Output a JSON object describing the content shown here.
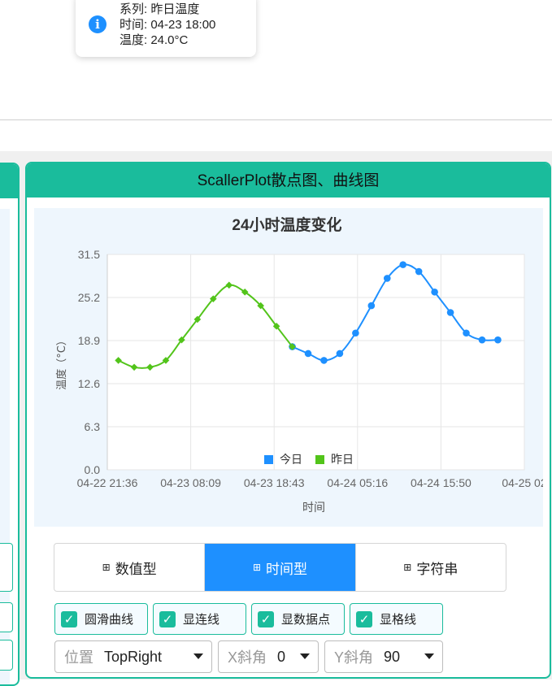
{
  "tooltip": {
    "series_line": "系列: 昨日温度",
    "time_line": "时间: 04-23 18:00",
    "temp_line": "温度: 24.0°C"
  },
  "card": {
    "title": "ScallerPlot散点图、曲线图"
  },
  "chart_data": {
    "type": "line",
    "title": "24小时温度变化",
    "xlabel": "时间",
    "ylabel": "温度（°C）",
    "ylim": [
      0,
      31.5
    ],
    "y_ticks": [
      "31.5",
      "25.2",
      "18.9",
      "12.6",
      "6.3",
      "0.0"
    ],
    "x_ticks": [
      "04-22 21:36",
      "04-23 08:09",
      "04-23 18:43",
      "04-24 05:16",
      "04-24 15:50",
      "04-25 02"
    ],
    "grid": true,
    "legend": {
      "position": "bottom-center",
      "entries": [
        "今日",
        "昨日"
      ]
    },
    "series": [
      {
        "name": "今日",
        "color": "#1e90ff",
        "marker": "circle",
        "x": [
          "04-23 21:00",
          "04-23 23:00",
          "04-24 01:00",
          "04-24 03:00",
          "04-24 05:00",
          "04-24 07:00",
          "04-24 09:00",
          "04-24 11:00",
          "04-24 13:00",
          "04-24 15:00",
          "04-24 17:00",
          "04-24 19:00",
          "04-24 21:00",
          "04-24 23:00"
        ],
        "values": [
          18.0,
          17.0,
          16.0,
          17.0,
          20.0,
          24.0,
          28.0,
          30.0,
          29.0,
          26.0,
          23.0,
          20.0,
          19.0,
          19.0
        ]
      },
      {
        "name": "昨日",
        "color": "#52c41a",
        "marker": "diamond",
        "x": [
          "04-22 23:00",
          "04-23 01:00",
          "04-23 03:00",
          "04-23 05:00",
          "04-23 07:00",
          "04-23 09:00",
          "04-23 11:00",
          "04-23 13:00",
          "04-23 15:00",
          "04-23 17:00",
          "04-23 19:00",
          "04-23 21:00"
        ],
        "values": [
          16.0,
          15.0,
          15.0,
          16.0,
          19.0,
          22.0,
          25.0,
          27.0,
          26.0,
          24.0,
          21.0,
          18.0
        ]
      }
    ]
  },
  "tabs": [
    {
      "icon": "grid-icon",
      "label": "数值型",
      "active": false
    },
    {
      "icon": "grid-icon",
      "label": "时间型",
      "active": true
    },
    {
      "icon": "grid-icon",
      "label": "字符串",
      "active": false
    }
  ],
  "checkboxes": [
    {
      "label": "圆滑曲线",
      "checked": true
    },
    {
      "label": "显连线",
      "checked": true
    },
    {
      "label": "显数据点",
      "checked": true
    },
    {
      "label": "显格线",
      "checked": true
    }
  ],
  "selects": {
    "position": {
      "label": "位置",
      "value": "TopRight"
    },
    "x_angle": {
      "label": "X斜角",
      "value": "0"
    },
    "y_angle": {
      "label": "Y斜角",
      "value": "90"
    }
  }
}
